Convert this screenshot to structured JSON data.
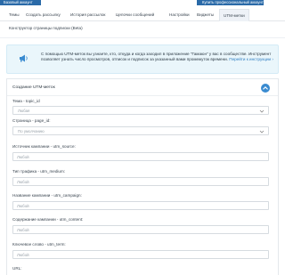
{
  "header": {
    "left_badge": "Базовый аккаунт",
    "right_badge": "Купить профессиональный аккаунт"
  },
  "tabs": [
    {
      "label": "Темы",
      "active": false
    },
    {
      "label": "Создать рассылку",
      "active": false
    },
    {
      "label": "История рассылок",
      "active": false
    },
    {
      "label": "Цепочки сообщений",
      "active": false
    },
    {
      "label": "Настройки",
      "active": false
    },
    {
      "label": "Виджеты",
      "active": false
    },
    {
      "label": "UTM-метки",
      "active": true
    }
  ],
  "subtab": "Конструктор страницы подписки (Beta)",
  "info": {
    "text_part1": "С помощью UTM-меток вы узнаете, кто, откуда и когда заходил в приложение \"Гамаюн\" у вас в сообществе.",
    "text_part2": " Инструмент позволяет узнать число просмотров, отписок и подписок за указанный вами промежуток времени.",
    "link": "Перейти к инструкции ›"
  },
  "form": {
    "title": "Создание UTM-меток",
    "fields": [
      {
        "label": "Тема - topic_id",
        "value": "Любая",
        "type": "select"
      },
      {
        "label": "Страница - page_id:",
        "value": "По умолчанию",
        "type": "select"
      },
      {
        "label": "Источник кампании - utm_source:",
        "placeholder": "Любой",
        "type": "input"
      },
      {
        "label": "Тип трафика - utm_medium:",
        "placeholder": "Любой",
        "type": "input"
      },
      {
        "label": "Название кампании - utm_campaign:",
        "placeholder": "Любой",
        "type": "input"
      },
      {
        "label": "Содержание кампании - utm_content:",
        "placeholder": "Любой",
        "type": "input"
      },
      {
        "label": "Ключевое слово - utm_term:",
        "placeholder": "Любой",
        "type": "input"
      },
      {
        "label": "URL:",
        "placeholder": "",
        "type": "input"
      }
    ]
  },
  "colors": {
    "accent": "#3a8bd0",
    "badge": "#2a6aa8",
    "info_bg": "#eaf6fb"
  }
}
